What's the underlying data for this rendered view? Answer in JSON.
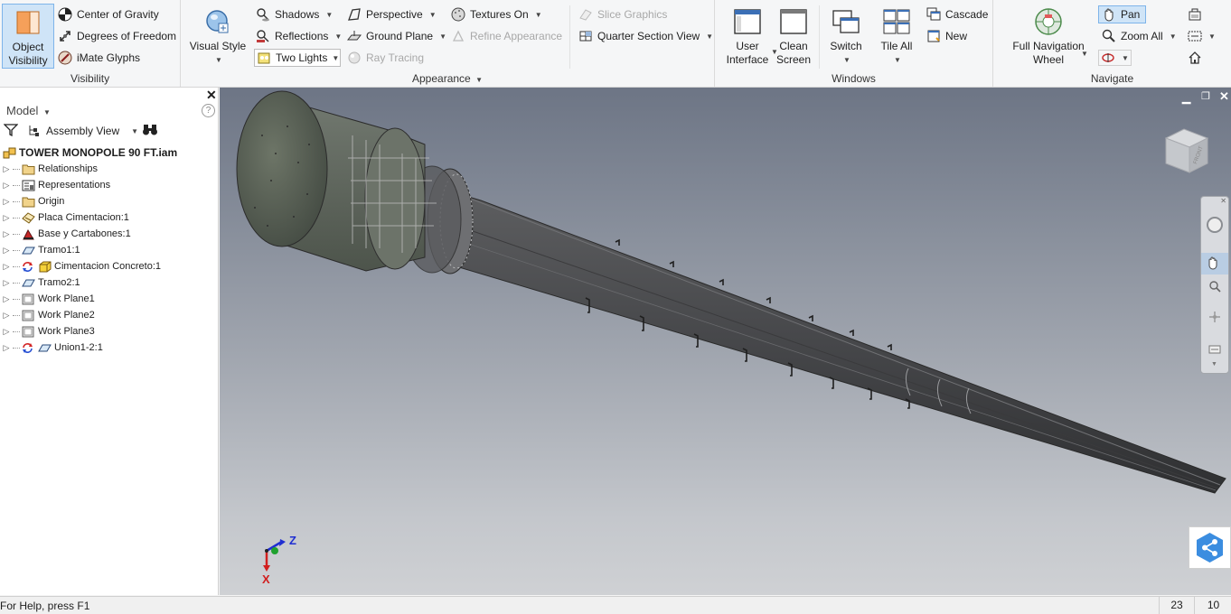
{
  "ribbon": {
    "visibility": {
      "title": "Visibility",
      "object_visibility": "Object\nVisibility",
      "center_of_gravity": "Center of Gravity",
      "degrees_of_freedom": "Degrees of Freedom",
      "imate_glyphs": "iMate Glyphs"
    },
    "appearance": {
      "title": "Appearance",
      "visual_style": "Visual Style",
      "shadows": "Shadows",
      "reflections": "Reflections",
      "two_lights": "Two Lights",
      "perspective": "Perspective",
      "ground_plane": "Ground Plane",
      "ray_tracing": "Ray Tracing",
      "textures_on": "Textures On",
      "refine_appearance": "Refine Appearance",
      "slice_graphics": "Slice Graphics",
      "quarter_section_view": "Quarter Section View"
    },
    "windows": {
      "title": "Windows",
      "user_interface": "User\nInterface",
      "clean_screen": "Clean\nScreen",
      "switch": "Switch",
      "tile_all": "Tile All",
      "cascade": "Cascade",
      "new": "New"
    },
    "navigate": {
      "title": "Navigate",
      "full_navigation_wheel": "Full Navigation\nWheel",
      "pan": "Pan",
      "zoom_all": "Zoom All"
    }
  },
  "browser": {
    "title": "Model",
    "view_mode": "Assembly View",
    "root": "TOWER MONOPOLE 90 FT.iam",
    "items": [
      {
        "label": "Relationships",
        "icon": "folder-icon"
      },
      {
        "label": "Representations",
        "icon": "representations-icon"
      },
      {
        "label": "Origin",
        "icon": "folder-icon"
      },
      {
        "label": "Placa Cimentacion:1",
        "icon": "part-icon"
      },
      {
        "label": "Base y Cartabones:1",
        "icon": "part-red-icon"
      },
      {
        "label": "Tramo1:1",
        "icon": "part-surface-icon"
      },
      {
        "label": "Cimentacion Concreto:1",
        "icon": "part-yellow-icon"
      },
      {
        "label": "Tramo2:1",
        "icon": "part-surface-icon"
      },
      {
        "label": "Work Plane1",
        "icon": "workplane-icon"
      },
      {
        "label": "Work Plane2",
        "icon": "workplane-icon"
      },
      {
        "label": "Work Plane3",
        "icon": "workplane-icon"
      },
      {
        "label": "Union1-2:1",
        "icon": "part-surface-icon"
      }
    ]
  },
  "viewport": {
    "axis_z": "Z",
    "axis_x": "X",
    "viewcube_face": "FRONT"
  },
  "status": {
    "help": "For Help, press F1",
    "count1": "23",
    "count2": "10"
  },
  "colors": {
    "accent": "#3b8de0",
    "selected_bg": "#cfe4f7",
    "axis_x": "#d11f1f",
    "axis_y": "#1fa12e",
    "axis_z": "#1f2ed1"
  }
}
